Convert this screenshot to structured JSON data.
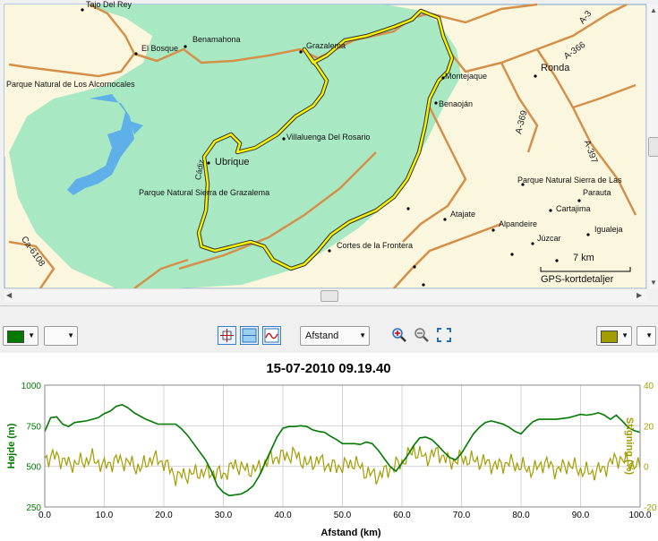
{
  "map": {
    "labels": {
      "tajo": "Tajo Del Rey",
      "benamahoma": "Benamahona",
      "el_bosque": "El Bosque",
      "grazalema": "Grazalema",
      "alcornocales": "Parque Natural de Los Alcornocales",
      "montejaque": "Montejaque",
      "ronda": "Ronda",
      "benaojan": "Benaoján",
      "villaluenga": "Villaluenga Del Rosario",
      "ubrique": "Ubrique",
      "cadiz": "Cádiz",
      "parque_grazalema": "Parque Natural Sierra de Grazalema",
      "parque_nieves": "Parque Natural Sierra de Las",
      "parauta": "Parauta",
      "cartajima": "Cartajima",
      "atajate": "Atajate",
      "alpandeire": "Alpandeire",
      "igualeja": "Igualeja",
      "juzcar": "Júzcar",
      "cortes": "Cortes de la Frontera",
      "a366": "A-366",
      "a369": "A-369",
      "a397": "A-397",
      "a3": "A-3",
      "ca6108": "Ca-6108"
    },
    "scale_label": "7 km",
    "detail_label": "GPS-kortdetaljer",
    "colors": {
      "park": "#a8e9c3",
      "land": "#fbf6de",
      "water": "#5fb0e8",
      "road": "#d4904a",
      "track": "#f7f000"
    }
  },
  "toolbar": {
    "left_color": "#007a00",
    "right_color": "#a39d00",
    "axis_mode": "Afstand",
    "icons": [
      "crosshair-icon",
      "split-view-icon",
      "graph-icon",
      "zoom-in-icon",
      "zoom-out-icon",
      "fit-icon"
    ]
  },
  "chart_data": {
    "type": "line",
    "title": "15-07-2010 09.19.40",
    "xlabel": "Afstand (km)",
    "ylabel_left": "Højde (m)",
    "ylabel_right": "Stigning (%)",
    "xlim": [
      0,
      100
    ],
    "ylim_left": [
      250,
      1000
    ],
    "ylim_right": [
      -20,
      40
    ],
    "xticks": [
      "0.0",
      "10.0",
      "20.0",
      "30.0",
      "40.0",
      "50.0",
      "60.0",
      "70.0",
      "80.0",
      "90.0",
      "100.0"
    ],
    "yticks_left": [
      "250",
      "500",
      "750",
      "1000"
    ],
    "yticks_right": [
      "-20",
      "0",
      "20",
      "40"
    ],
    "grid": true,
    "series": [
      {
        "name": "Højde (m)",
        "color": "#007a00",
        "x": [
          0,
          1,
          2,
          3,
          4,
          5,
          6,
          7,
          8,
          9,
          10,
          11,
          12,
          13,
          14,
          15,
          16,
          17,
          18,
          19,
          20,
          21,
          22,
          23,
          24,
          25,
          26,
          27,
          28,
          29,
          30,
          31,
          32,
          33,
          34,
          35,
          36,
          37,
          38,
          39,
          40,
          41,
          42,
          43,
          44,
          45,
          46,
          47,
          48,
          49,
          50,
          51,
          52,
          53,
          54,
          55,
          56,
          57,
          58,
          59,
          60,
          61,
          62,
          63,
          64,
          65,
          66,
          67,
          68,
          69,
          70,
          71,
          72,
          73,
          74,
          75,
          76,
          77,
          78,
          79,
          80,
          81,
          82,
          83,
          84,
          85,
          86,
          87,
          88,
          89,
          90,
          91,
          92,
          93,
          94,
          95,
          96,
          97,
          98,
          99,
          100
        ],
        "values": [
          715,
          800,
          805,
          760,
          745,
          770,
          775,
          780,
          790,
          800,
          825,
          840,
          870,
          880,
          860,
          830,
          810,
          790,
          775,
          760,
          760,
          760,
          760,
          730,
          690,
          640,
          590,
          540,
          470,
          380,
          340,
          320,
          325,
          330,
          350,
          380,
          440,
          520,
          600,
          680,
          735,
          745,
          745,
          750,
          745,
          725,
          715,
          710,
          685,
          665,
          640,
          640,
          640,
          635,
          650,
          640,
          600,
          550,
          500,
          470,
          520,
          570,
          630,
          675,
          680,
          665,
          630,
          590,
          555,
          540,
          580,
          640,
          700,
          740,
          770,
          780,
          770,
          760,
          740,
          715,
          700,
          740,
          775,
          790,
          790,
          790,
          790,
          795,
          800,
          810,
          820,
          815,
          820,
          830,
          815,
          790,
          815,
          780,
          740,
          720,
          710
        ]
      },
      {
        "name": "Stigning (%)",
        "color": "#a39d00",
        "note": "noisy gradient series, sampled",
        "x": [
          0,
          2,
          4,
          6,
          8,
          10,
          12,
          14,
          16,
          18,
          20,
          22,
          24,
          26,
          28,
          30,
          32,
          34,
          36,
          38,
          40,
          42,
          44,
          46,
          48,
          50,
          52,
          54,
          56,
          58,
          60,
          62,
          64,
          66,
          68,
          70,
          72,
          74,
          76,
          78,
          80,
          82,
          84,
          86,
          88,
          90,
          92,
          94,
          96,
          98,
          100
        ],
        "values": [
          4,
          5,
          1,
          2,
          4,
          0,
          3,
          2,
          -1,
          4,
          2,
          -5,
          -4,
          -3,
          -3,
          -4,
          1,
          -2,
          -1,
          4,
          5,
          6,
          1,
          3,
          0,
          0,
          2,
          -3,
          -5,
          -1,
          2,
          8,
          4,
          7,
          2,
          4,
          3,
          2,
          0,
          2,
          0,
          -2,
          2,
          -2,
          1,
          -2,
          -3,
          -1,
          4,
          2,
          -1
        ]
      }
    ]
  }
}
